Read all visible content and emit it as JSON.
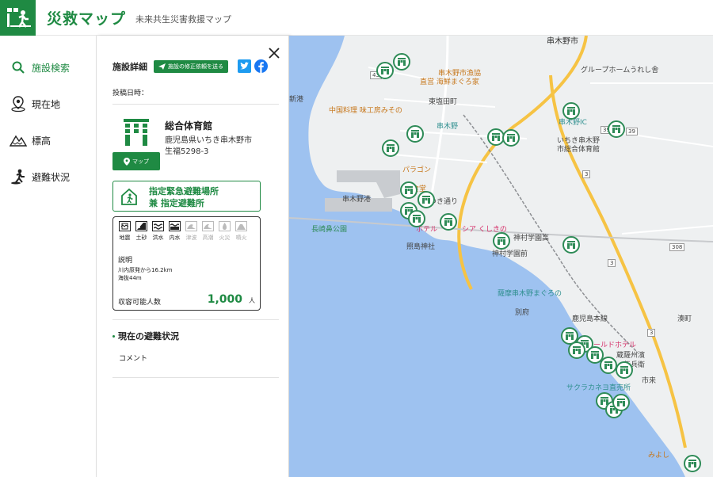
{
  "header": {
    "title": "災救マップ",
    "subtitle": "未来共生災害救援マップ"
  },
  "sidebar": {
    "items": [
      {
        "label": "施設検索",
        "icon": "search-icon",
        "active": true
      },
      {
        "label": "現在地",
        "icon": "location-icon",
        "active": false
      },
      {
        "label": "標高",
        "icon": "elevation-icon",
        "active": false
      },
      {
        "label": "避難状況",
        "icon": "evacuation-icon",
        "active": false
      }
    ]
  },
  "panel": {
    "title": "施設詳細",
    "request_button": "施設の修正依頼を送る",
    "post_date_label": "投稿日時：",
    "facility_name": "総合体育館",
    "address_line1": "鹿児島県いちき串木野市",
    "address_line2": "生福5298-3",
    "map_button": "マップ",
    "shelter_line1": "指定緊急避難場所",
    "shelter_line2": "兼 指定避難所",
    "hazards": [
      {
        "label": "地震",
        "enabled": true
      },
      {
        "label": "土砂",
        "enabled": true
      },
      {
        "label": "洪水",
        "enabled": true
      },
      {
        "label": "内水",
        "enabled": true
      },
      {
        "label": "津波",
        "enabled": false
      },
      {
        "label": "高潮",
        "enabled": false
      },
      {
        "label": "火災",
        "enabled": false
      },
      {
        "label": "噴火",
        "enabled": false
      }
    ],
    "description_label": "説明",
    "description_line1": "川内原発から16.2km",
    "description_line2": "海抜44m",
    "capacity_label": "収容可能人数",
    "capacity_value": "1,000",
    "capacity_unit": "人",
    "status_title": "現在の避難状況",
    "comment_label": "コメント"
  },
  "map": {
    "labels": [
      {
        "text": "串木野市"
      },
      {
        "text": "串木野市漁協"
      },
      {
        "text": "直営 海鮮まぐろ家"
      },
      {
        "text": "グループホームうれし舎"
      },
      {
        "text": "東塩田町"
      },
      {
        "text": "中国料理 味工房みその"
      },
      {
        "text": "串木野"
      },
      {
        "text": "串木野IC"
      },
      {
        "text": "いちき串木野"
      },
      {
        "text": "市総合体育館"
      },
      {
        "text": "パラゴン"
      },
      {
        "text": "学食堂"
      },
      {
        "text": "串木野港"
      },
      {
        "text": "長崎鼻公園"
      },
      {
        "text": "ホテル"
      },
      {
        "text": "シア くしきの"
      },
      {
        "text": "照島神社"
      },
      {
        "text": "神村学園前"
      },
      {
        "text": "神村学園高"
      },
      {
        "text": "薩摩串木野まぐろの"
      },
      {
        "text": "別府"
      },
      {
        "text": "湊町"
      },
      {
        "text": "ィールドホテル"
      },
      {
        "text": "蔵薩州濱"
      },
      {
        "text": "伝兵衛"
      },
      {
        "text": "サクラカネヨ直売所"
      },
      {
        "text": "市来"
      },
      {
        "text": "みよし"
      },
      {
        "text": "新港"
      },
      {
        "text": "さつき通り"
      },
      {
        "text": "鹿児島本線"
      }
    ],
    "road_numbers": [
      "43",
      "39",
      "39",
      "3",
      "3",
      "308",
      "3"
    ],
    "colors": {
      "brand": "#1f8a43",
      "sea": "#9ec2f0",
      "land": "#eef0f1",
      "highway": "#f6c344"
    }
  }
}
